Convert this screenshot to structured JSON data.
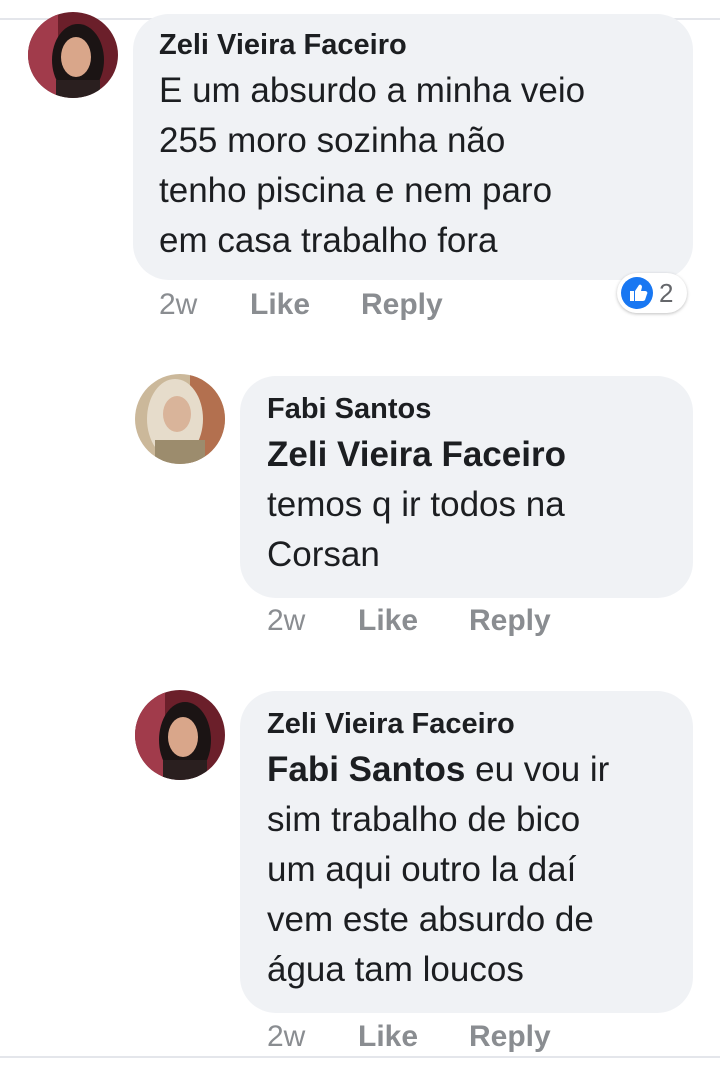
{
  "comments": [
    {
      "author": "Zeli Vieira Faceiro",
      "text_lines": [
        "E um absurdo  a minha veio",
        "255  moro sozinha não",
        "tenho piscina e nem paro",
        "em  casa  trabalho fora"
      ],
      "time": "2w",
      "like_label": "Like",
      "reply_label": "Reply",
      "reaction": {
        "icon": "thumbs-up-icon",
        "count": "2",
        "color": "#1877f2"
      }
    },
    {
      "author": "Fabi Santos",
      "mention": "Zeli Vieira Faceiro",
      "text_lines": [
        "temos q ir todos na",
        "Corsan"
      ],
      "time": "2w",
      "like_label": "Like",
      "reply_label": "Reply"
    },
    {
      "author": "Zeli Vieira Faceiro",
      "mention": "Fabi Santos",
      "text_lines": [
        " eu vou ir",
        "sim trabalho   de bico",
        "um aqui  outro la daí",
        "vem este absurdo  de",
        "água  tam loucos"
      ],
      "time": "2w",
      "like_label": "Like",
      "reply_label": "Reply"
    }
  ],
  "colors": {
    "bubble": "#f0f2f5",
    "meta": "#8a8d91",
    "text": "#1c1e21"
  }
}
